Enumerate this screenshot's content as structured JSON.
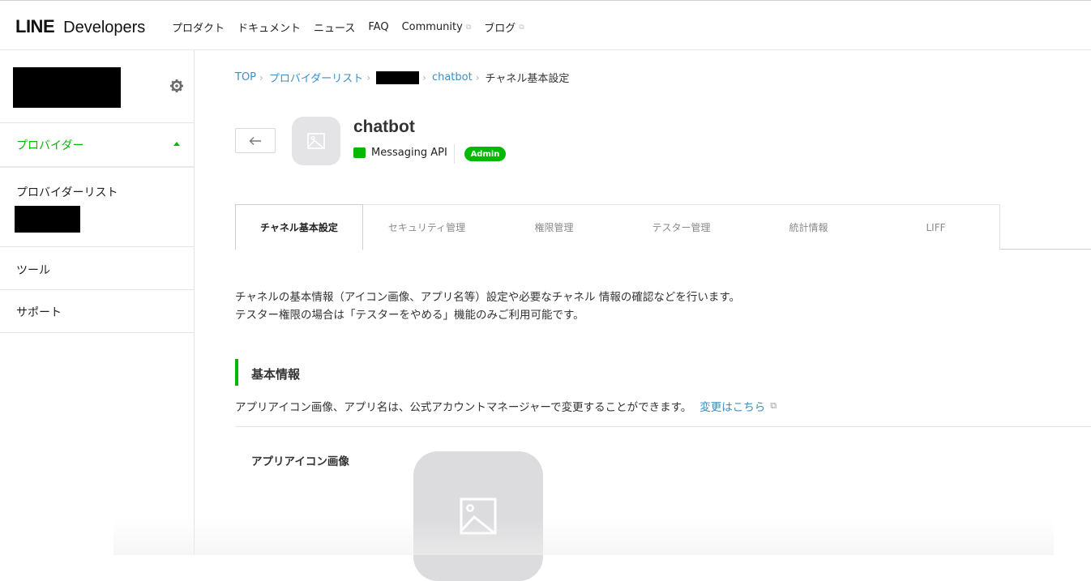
{
  "header": {
    "logo_line": "LINE",
    "logo_dev": "Developers",
    "nav": [
      {
        "label": "プロダクト",
        "external": false
      },
      {
        "label": "ドキュメント",
        "external": false
      },
      {
        "label": "ニュース",
        "external": false
      },
      {
        "label": "FAQ",
        "external": false
      },
      {
        "label": "Community",
        "external": true
      },
      {
        "label": "ブログ",
        "external": true
      }
    ]
  },
  "sidebar": {
    "provider_section": "プロバイダー",
    "provider_list": "プロバイダーリスト",
    "tools": "ツール",
    "support": "サポート"
  },
  "breadcrumb": {
    "top": "TOP",
    "provider_list": "プロバイダーリスト",
    "channel": "chatbot",
    "current": "チャネル基本設定"
  },
  "channel": {
    "name": "chatbot",
    "type": "Messaging API",
    "role": "Admin"
  },
  "tabs": [
    {
      "label": "チャネル基本設定",
      "active": true
    },
    {
      "label": "セキュリティ管理",
      "active": false
    },
    {
      "label": "権限管理",
      "active": false
    },
    {
      "label": "テスター管理",
      "active": false
    },
    {
      "label": "統計情報",
      "active": false
    },
    {
      "label": "LIFF",
      "active": false
    }
  ],
  "description": {
    "line1": "チャネルの基本情報（アイコン画像、アプリ名等）設定や必要なチャネル 情報の確認などを行います。",
    "line2": "テスター権限の場合は「テスターをやめる」機能のみご利用可能です。"
  },
  "basic_info": {
    "title": "基本情報",
    "note": "アプリアイコン画像、アプリ名は、公式アカウントマネージャーで変更することができます。",
    "link": "変更はこちら",
    "icon_label": "アプリアイコン画像"
  },
  "colors": {
    "accent": "#00b900",
    "link": "#3a8fc9"
  }
}
